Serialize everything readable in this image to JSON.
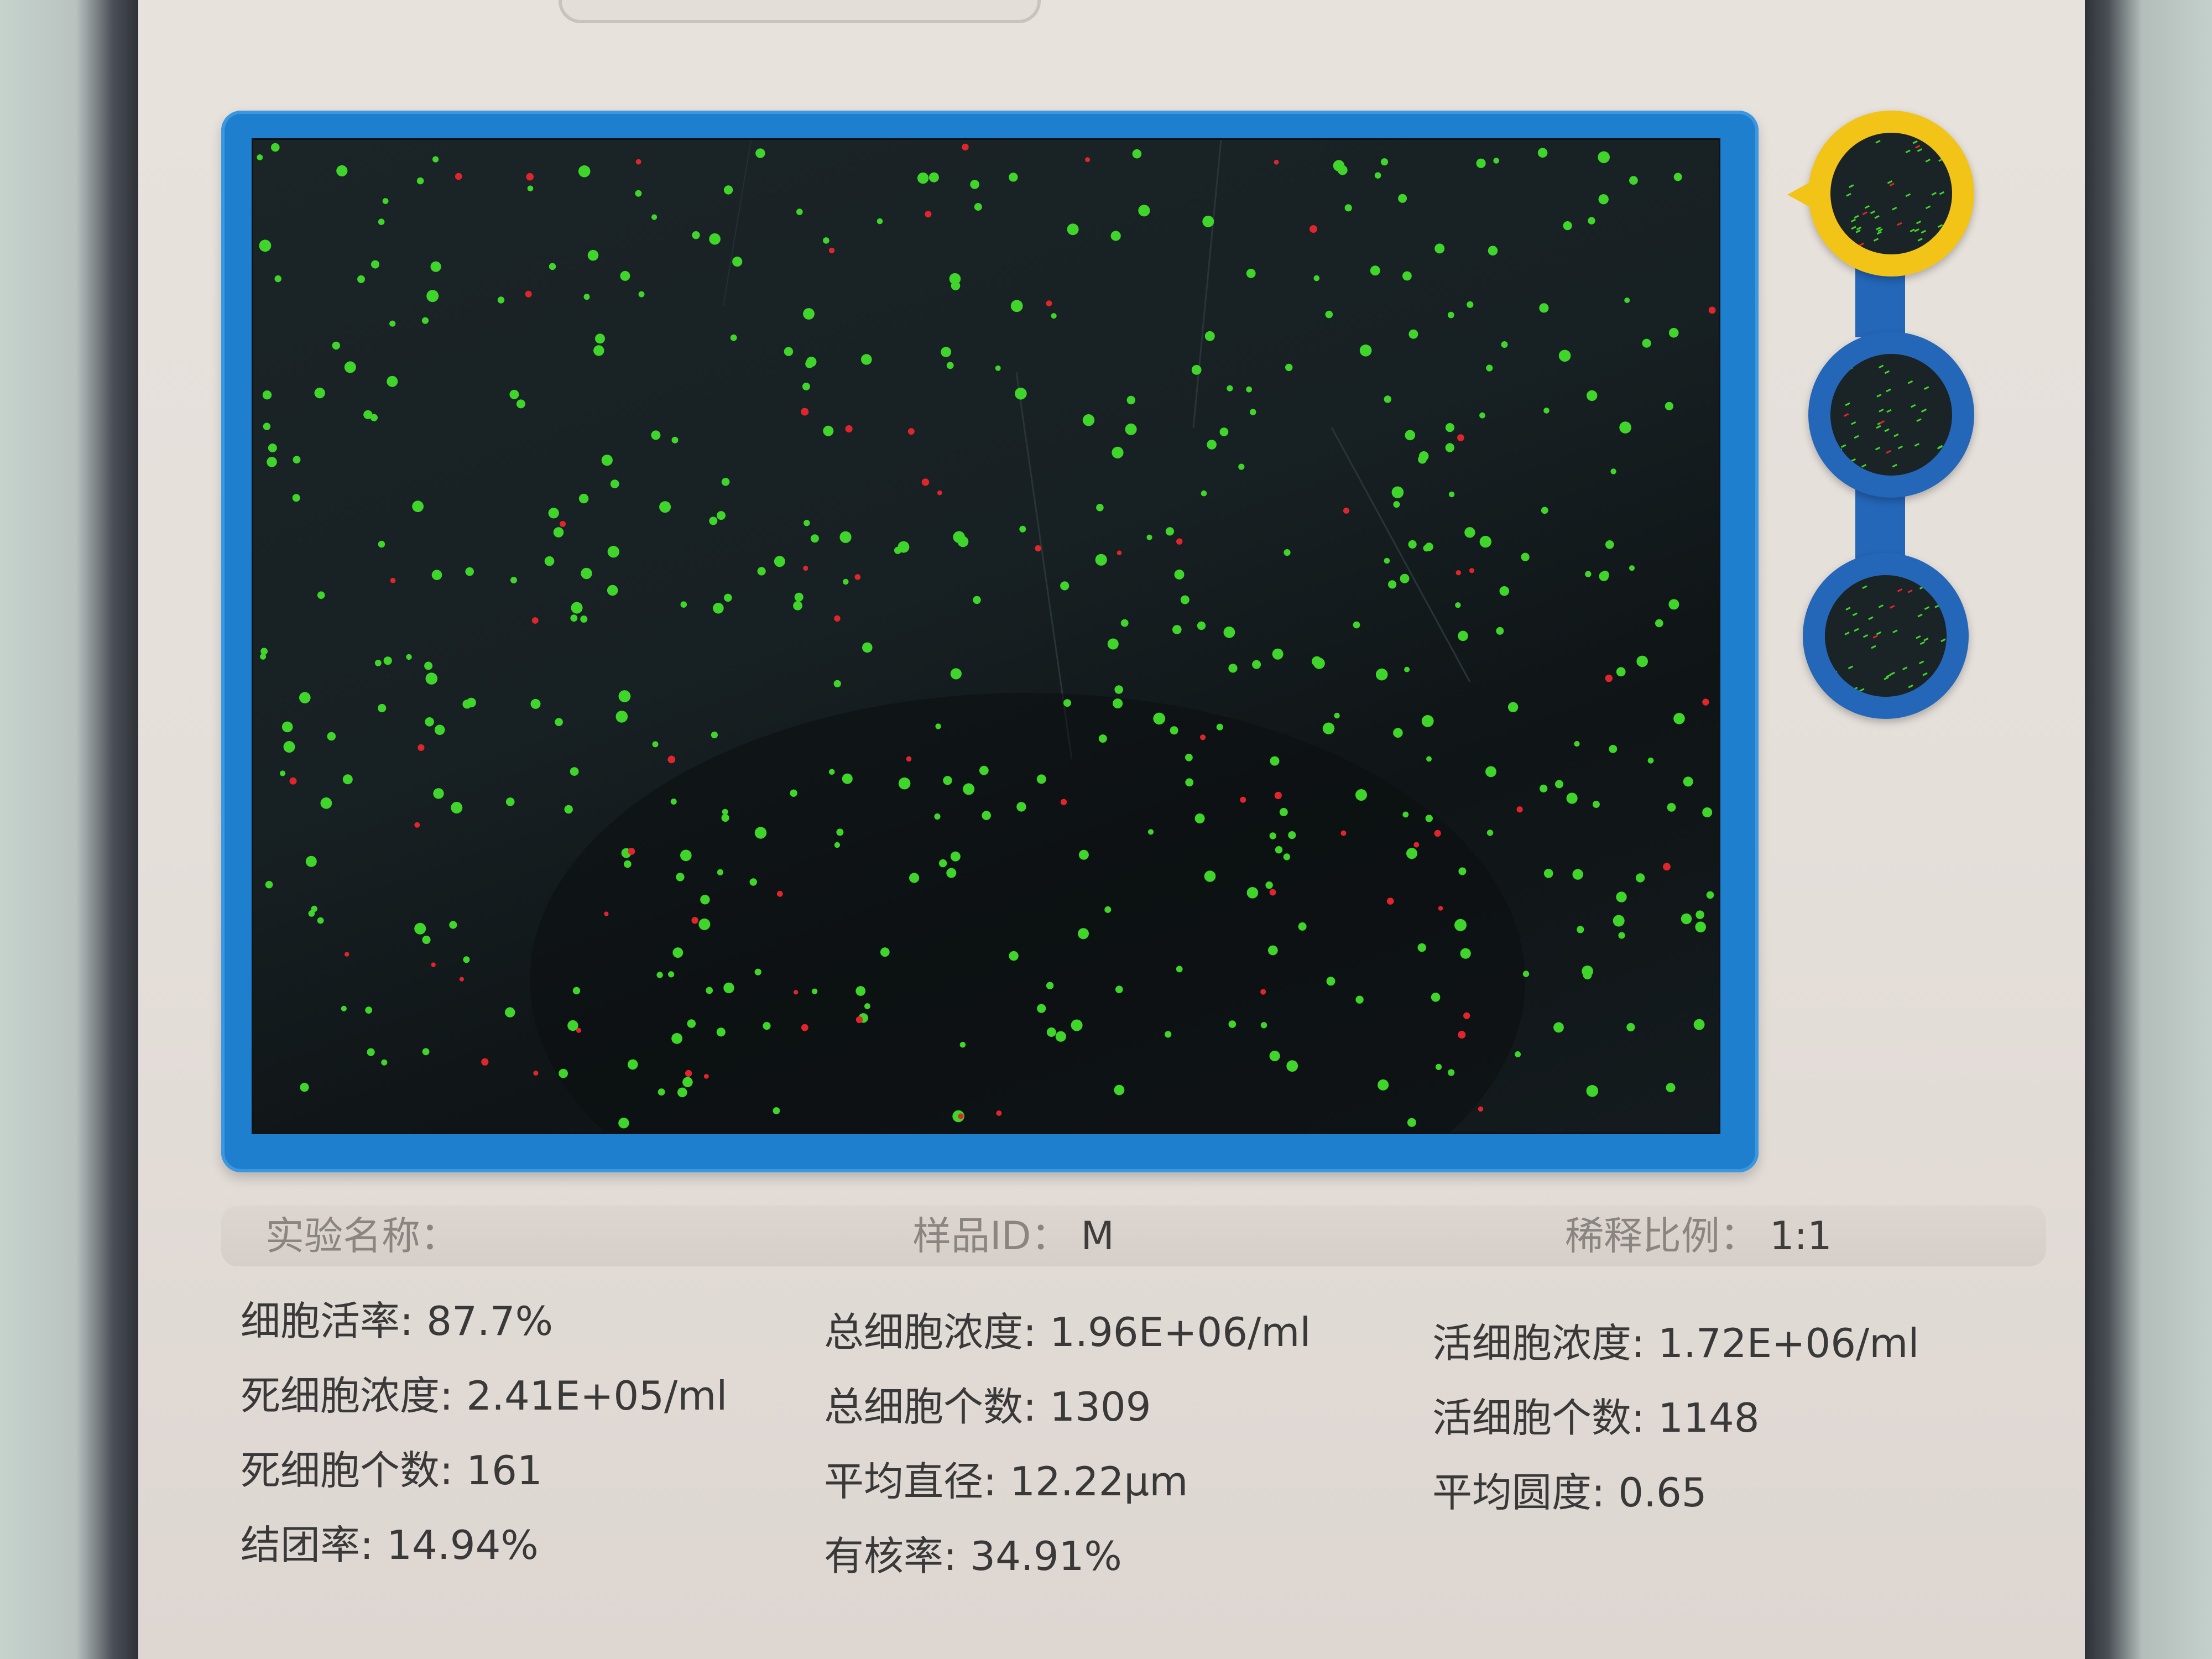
{
  "header": {
    "experiment_label": "实验名称：",
    "experiment_value": "",
    "sample_id_label": "样品ID：",
    "sample_id_value": "M",
    "dilution_label": "稀释比例：",
    "dilution_value": "1:1"
  },
  "stats": {
    "col1": [
      {
        "label": "细胞活率:",
        "value": "87.7%"
      },
      {
        "label": "死细胞浓度:",
        "value": "2.41E+05/ml"
      },
      {
        "label": "死细胞个数:",
        "value": "161"
      },
      {
        "label": "结团率:",
        "value": "14.94%"
      }
    ],
    "col2": [
      {
        "label": "总细胞浓度:",
        "value": "1.96E+06/ml"
      },
      {
        "label": "总细胞个数:",
        "value": "1309"
      },
      {
        "label": "平均直径:",
        "value": "12.22μm"
      },
      {
        "label": "有核率:",
        "value": "34.91%"
      }
    ],
    "col3": [
      {
        "label": "活细胞浓度:",
        "value": "1.72E+06/ml"
      },
      {
        "label": "活细胞个数:",
        "value": "1148"
      },
      {
        "label": "平均圆度:",
        "value": "0.65"
      }
    ]
  },
  "image_view": {
    "live_color": "#3fd52a",
    "dead_color": "#e0262c",
    "background": "#172023"
  },
  "thumbnails": {
    "active_index": 0,
    "count": 3,
    "active_color": "#f2c418",
    "inactive_color": "#2466b8"
  }
}
